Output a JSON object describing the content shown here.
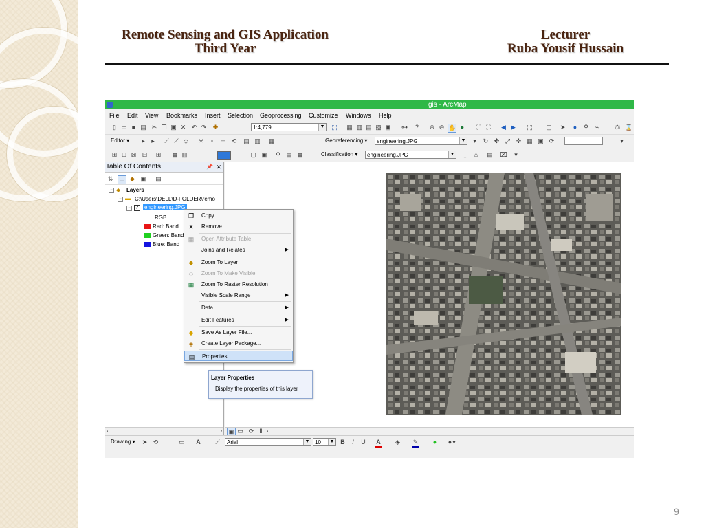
{
  "slide": {
    "header_left_line1": "Remote Sensing and GIS Application",
    "header_left_line2": "Third Year",
    "header_right_line1": "Lecturer",
    "header_right_line2": "Ruba Yousif Hussain",
    "page_number": "9"
  },
  "window": {
    "title": "gis - ArcMap"
  },
  "menu": [
    "File",
    "Edit",
    "View",
    "Bookmarks",
    "Insert",
    "Selection",
    "Geoprocessing",
    "Customize",
    "Windows",
    "Help"
  ],
  "toolbar": {
    "scale_value": "1:4,779",
    "editor_label": "Editor ▾",
    "georeferencing_label": "Georeferencing ▾",
    "georef_layer": "engineering.JPG",
    "classification_label": "Classification ▾",
    "classification_layer": "engineering.JPG"
  },
  "toc": {
    "title": "Table Of Contents",
    "pin_icon": "pin-icon",
    "close_glyph": "✕",
    "layers_label": "Layers",
    "folder_path": "C:\\Users\\DELL\\D-FOLDER\\remo",
    "layer_name": "engineering.JPG",
    "rgb_label": "RGB",
    "bands": [
      {
        "label": "Red:",
        "value": "Band",
        "color": "#e81515"
      },
      {
        "label": "Green:",
        "value": "Band",
        "color": "#20d020"
      },
      {
        "label": "Blue:",
        "value": "Band",
        "color": "#1414e0"
      }
    ]
  },
  "context_menu": {
    "items": [
      {
        "label": "Copy",
        "icon": "copy-icon",
        "disabled": false
      },
      {
        "label": "Remove",
        "icon": "remove-icon",
        "disabled": false
      },
      {
        "label": "Open Attribute Table",
        "icon": "table-icon",
        "disabled": true
      },
      {
        "label": "Joins and Relates",
        "icon": "",
        "disabled": false,
        "submenu": true
      },
      {
        "label": "Zoom To Layer",
        "icon": "zoom-layer-icon",
        "disabled": false
      },
      {
        "label": "Zoom To Make Visible",
        "icon": "zoom-visible-icon",
        "disabled": true
      },
      {
        "label": "Zoom To Raster Resolution",
        "icon": "raster-resolution-icon",
        "disabled": false
      },
      {
        "label": "Visible Scale Range",
        "icon": "",
        "disabled": false,
        "submenu": true
      },
      {
        "label": "Data",
        "icon": "",
        "disabled": false,
        "submenu": true
      },
      {
        "label": "Edit Features",
        "icon": "",
        "disabled": false,
        "submenu": true
      },
      {
        "label": "Save As Layer File...",
        "icon": "save-layer-icon",
        "disabled": false
      },
      {
        "label": "Create Layer Package...",
        "icon": "layer-package-icon",
        "disabled": false
      },
      {
        "label": "Properties...",
        "icon": "properties-icon",
        "disabled": false,
        "highlighted": true
      }
    ]
  },
  "tooltip": {
    "title": "Layer Properties",
    "description": "Display the properties of this layer"
  },
  "drawing_toolbar": {
    "drawing_label": "Drawing ▾",
    "font_name": "Arial",
    "font_size": "10",
    "bold": "B",
    "italic": "I",
    "underline": "U"
  },
  "colors": {
    "titlebar": "#2fb847",
    "header_text": "#4a2410",
    "selection": "#3399ff"
  }
}
